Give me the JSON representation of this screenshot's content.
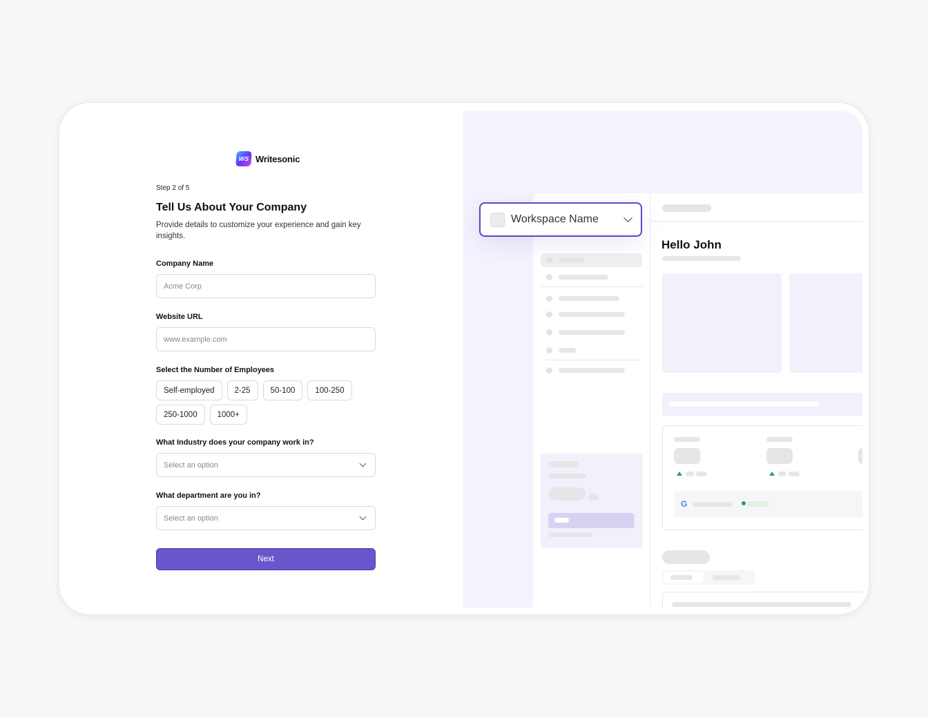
{
  "brand": {
    "logo_mark": "WS",
    "name": "Writesonic"
  },
  "form": {
    "step": "Step 2 of 5",
    "title": "Tell Us About Your Company",
    "subtitle": "Provide details to customize your experience and gain key insights.",
    "company_name": {
      "label": "Company Name",
      "placeholder": "Acme Corp"
    },
    "website_url": {
      "label": "Website URL",
      "placeholder": "www.example.com"
    },
    "employees": {
      "label": "Select the Number of Employees",
      "options": [
        "Self-employed",
        "2-25",
        "50-100",
        "100-250",
        "250-1000",
        "1000+"
      ]
    },
    "industry": {
      "label": "What Industry does your company work in?",
      "placeholder": "Select an option"
    },
    "department": {
      "label": "What department are you in?",
      "placeholder": "Select an option"
    },
    "next_label": "Next"
  },
  "preview": {
    "workspace_name": "Workspace Name",
    "greeting": "Hello John"
  },
  "colors": {
    "accent": "#6a55cc",
    "preview_bg": "#f4f2fd",
    "dropdown_border": "#5b47c2"
  }
}
